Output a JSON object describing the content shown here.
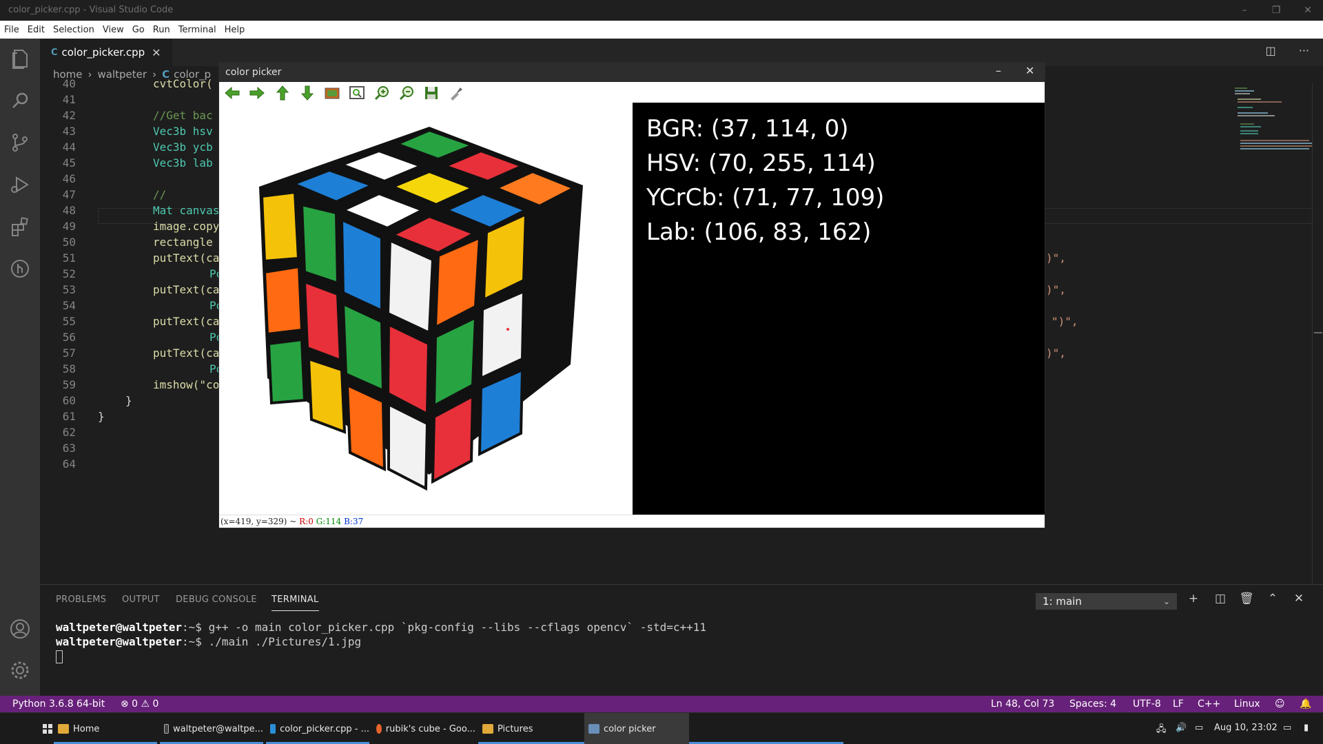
{
  "window": {
    "title": "color_picker.cpp - Visual Studio Code"
  },
  "menu": [
    "File",
    "Edit",
    "Selection",
    "View",
    "Go",
    "Run",
    "Terminal",
    "Help"
  ],
  "activity": [
    "files-icon",
    "search-icon",
    "source-control-icon",
    "run-debug-icon",
    "extensions-icon",
    "git-graph-icon",
    "account-icon",
    "settings-gear-icon"
  ],
  "editor": {
    "tab": {
      "icon": "C",
      "name": "color_picker.cpp",
      "close": "✕"
    },
    "breadcrumb": [
      "home",
      "waltpeter",
      "color_p"
    ],
    "lines": [
      {
        "n": "40",
        "t": "cvtColor("
      },
      {
        "n": "41",
        "t": ""
      },
      {
        "n": "42",
        "t": "//Get bac"
      },
      {
        "n": "43",
        "t": "Vec3b hsv"
      },
      {
        "n": "44",
        "t": "Vec3b ycb"
      },
      {
        "n": "45",
        "t": "Vec3b lab"
      },
      {
        "n": "46",
        "t": ""
      },
      {
        "n": "47",
        "t": "//"
      },
      {
        "n": "48",
        "t": "Mat canvas"
      },
      {
        "n": "49",
        "t": "image.copy"
      },
      {
        "n": "50",
        "t": "rectangle"
      },
      {
        "n": "51",
        "t": "putText(ca"
      },
      {
        "n": "52",
        "t": "Po"
      },
      {
        "n": "53",
        "t": "putText(ca"
      },
      {
        "n": "54",
        "t": "Po"
      },
      {
        "n": "55",
        "t": "putText(ca"
      },
      {
        "n": "56",
        "t": "Po"
      },
      {
        "n": "57",
        "t": "putText(ca"
      },
      {
        "n": "58",
        "t": "Po"
      },
      {
        "n": "59",
        "t": "imshow(\"co"
      },
      {
        "n": "60",
        "t": "}"
      },
      {
        "n": "61",
        "t": "}"
      },
      {
        "n": "62",
        "t": ""
      },
      {
        "n": "63",
        "t": ""
      },
      {
        "n": "64",
        "t": ""
      }
    ],
    "right_fragments": [
      ")\",",
      ")\",",
      "\")\",",
      ")\","
    ]
  },
  "picker": {
    "title": "color picker",
    "toolbar": [
      "arrow-left-icon",
      "arrow-right-icon",
      "arrow-up-icon",
      "arrow-down-icon",
      "image-icon",
      "zoom-fit-icon",
      "zoom-in-icon",
      "zoom-out-icon",
      "save-icon",
      "properties-icon"
    ],
    "info": [
      "BGR: (37, 114, 0)",
      "HSV: (70, 255, 114)",
      "YCrCb: (71, 77, 109)",
      "Lab: (106, 83, 162)"
    ],
    "status": {
      "coords": "(x=419, y=329) ~",
      "r": "R:0",
      "g": "G:114",
      "b": "B:37"
    }
  },
  "panel": {
    "tabs": [
      "PROBLEMS",
      "OUTPUT",
      "DEBUG CONSOLE",
      "TERMINAL"
    ],
    "terminal_select": "1: main",
    "terminal": [
      {
        "prompt": "waltpeter@waltpeter",
        "rest": ":~$ g++ -o main color_picker.cpp `pkg-config --libs --cflags opencv` -std=c++11"
      },
      {
        "prompt": "waltpeter@waltpeter",
        "rest": ":~$ ./main ./Pictures/1.jpg"
      }
    ]
  },
  "status": {
    "python": "Python 3.6.8 64-bit",
    "problems": "⊗ 0 ⚠ 0",
    "position": "Ln 48, Col 73",
    "spaces": "Spaces: 4",
    "encoding": "UTF-8",
    "eol": "LF",
    "language": "C++",
    "os": "Linux"
  },
  "taskbar": {
    "items": [
      {
        "label": "Home",
        "color": "#e0a93a"
      },
      {
        "label": "waltpeter@waltpe...",
        "color": "#444444"
      },
      {
        "label": "color_picker.cpp - ...",
        "color": "#2b8fd6"
      },
      {
        "label": "rubik's cube - Goo...",
        "color": "#e6642c"
      },
      {
        "label": "Pictures",
        "color": "#e0a93a"
      },
      {
        "label": "color picker",
        "color": "#6a8fb8"
      }
    ],
    "clock": "Aug 10, 23:02"
  },
  "colors": {
    "statusbar": "#68217a",
    "editor_bg": "#1e1e1e",
    "activity_bg": "#333333"
  }
}
